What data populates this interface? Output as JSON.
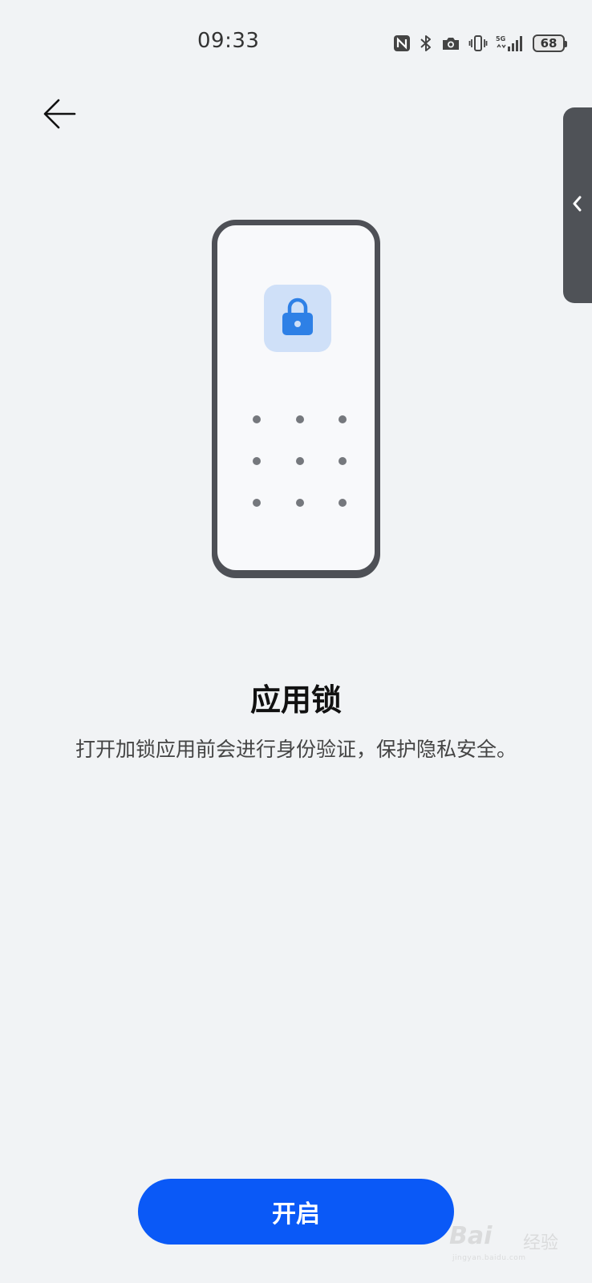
{
  "status_bar": {
    "time": "09:33",
    "battery_level": "68",
    "icons": [
      "nfc-icon",
      "bluetooth-icon",
      "camera-icon",
      "vibrate-icon",
      "signal-5g-icon",
      "battery-icon"
    ]
  },
  "header": {
    "back_icon": "arrow-left-icon"
  },
  "side_panel": {
    "icon": "chevron-left-icon"
  },
  "illustration": {
    "lock_icon": "lock-icon",
    "accent_color": "#2e80e6",
    "tile_color": "#cfe0f8"
  },
  "content": {
    "title": "应用锁",
    "description": "打开加锁应用前会进行身份验证，保护隐私安全。"
  },
  "actions": {
    "enable_label": "开启",
    "button_color": "#0a59f7"
  },
  "watermark": {
    "brand": "Bai",
    "text": "经验",
    "sub": "jingyan.baidu.com"
  }
}
